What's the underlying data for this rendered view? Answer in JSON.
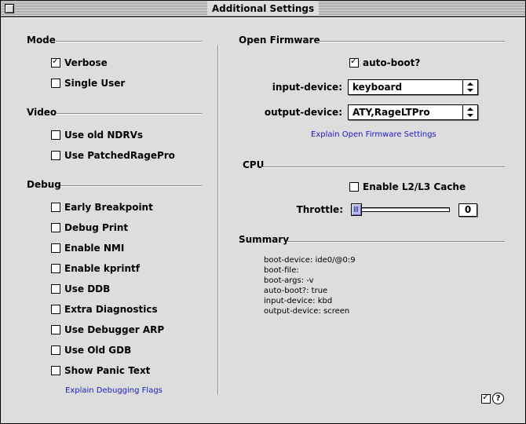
{
  "window": {
    "title": "Additional Settings"
  },
  "mode": {
    "title": "Mode",
    "items": [
      {
        "label": "Verbose",
        "checked": true
      },
      {
        "label": "Single User",
        "checked": false
      }
    ]
  },
  "video": {
    "title": "Video",
    "items": [
      {
        "label": "Use old NDRVs",
        "checked": false
      },
      {
        "label": "Use PatchedRagePro",
        "checked": false
      }
    ]
  },
  "debug": {
    "title": "Debug",
    "items": [
      {
        "label": "Early Breakpoint",
        "checked": false
      },
      {
        "label": "Debug Print",
        "checked": false
      },
      {
        "label": "Enable NMI",
        "checked": false
      },
      {
        "label": "Enable kprintf",
        "checked": false
      },
      {
        "label": "Use DDB",
        "checked": false
      },
      {
        "label": "Extra Diagnostics",
        "checked": false
      },
      {
        "label": "Use Debugger ARP",
        "checked": false
      },
      {
        "label": "Use Old GDB",
        "checked": false
      },
      {
        "label": "Show Panic Text",
        "checked": false
      }
    ],
    "explain_link": "Explain Debugging Flags"
  },
  "open_firmware": {
    "title": "Open Firmware",
    "auto_boot": {
      "label": "auto-boot?",
      "checked": true
    },
    "input_device": {
      "label": "input-device:",
      "value": "keyboard"
    },
    "output_device": {
      "label": "output-device:",
      "value": "ATY,RageLTPro"
    },
    "explain_link": "Explain Open Firmware Settings"
  },
  "cpu": {
    "title": "CPU",
    "cache": {
      "label": "Enable L2/L3 Cache",
      "checked": false
    },
    "throttle": {
      "label": "Throttle:",
      "value": "0",
      "fraction": 0.0
    }
  },
  "summary": {
    "title": "Summary",
    "lines": [
      "boot-device: ide0/@0:9",
      "boot-file:",
      "boot-args: -v",
      "auto-boot?: true",
      "input-device: kbd",
      "output-device: screen"
    ]
  },
  "colors": {
    "link": "#1a1ad0",
    "window_bg": "#dddddd",
    "thumb": "#b8b8f0"
  },
  "icons": {
    "close": "close-box-icon",
    "help": "help-icon",
    "small_check": "checkbox-icon"
  }
}
